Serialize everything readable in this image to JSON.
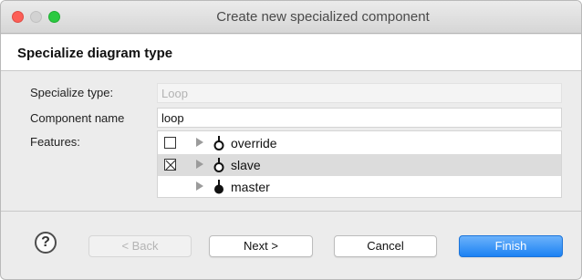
{
  "window": {
    "title": "Create new specialized component"
  },
  "header": {
    "title": "Specialize diagram type"
  },
  "form": {
    "specialize_type_label": "Specialize type:",
    "specialize_type_value": "Loop",
    "component_name_label": "Component name",
    "component_name_value": "loop",
    "features_label": "Features:"
  },
  "features": [
    {
      "label": "override",
      "checked": false,
      "icon": "hollow-node-icon"
    },
    {
      "label": "slave",
      "checked": true,
      "selected": true,
      "icon": "hollow-node-icon"
    },
    {
      "label": "master",
      "checked": null,
      "icon": "filled-node-icon"
    }
  ],
  "footer": {
    "help_label": "?",
    "back_label": "< Back",
    "next_label": "Next >",
    "cancel_label": "Cancel",
    "finish_label": "Finish"
  }
}
